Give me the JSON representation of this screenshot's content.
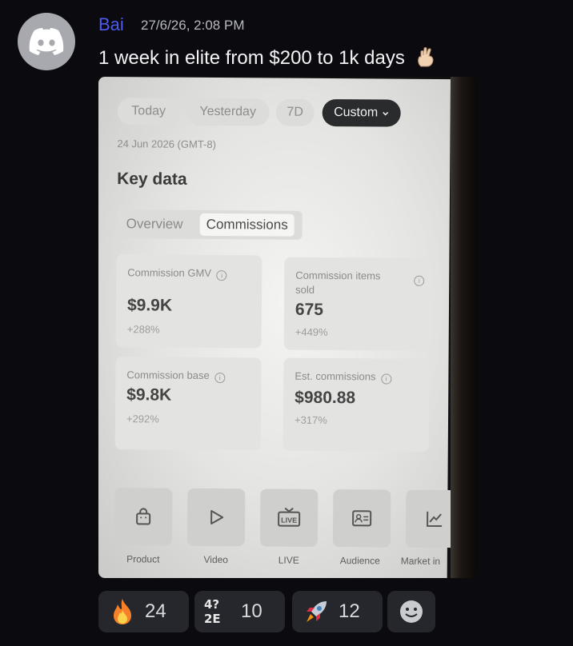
{
  "message": {
    "username": "Bai",
    "timestamp": "27/6/26, 2:08 PM",
    "text": "1 week in elite from $200 to 1k days",
    "text_emoji": "crossed-fingers-icon"
  },
  "photo": {
    "filters": [
      {
        "label": "Today",
        "active": false
      },
      {
        "label": "Yesterday",
        "active": false
      },
      {
        "label": "7D",
        "active": false
      },
      {
        "label": "Custom",
        "active": true
      }
    ],
    "date": "24 Jun 2026 (GMT-8)",
    "section_title": "Key data",
    "tabs": [
      {
        "label": "Overview",
        "active": false
      },
      {
        "label": "Commissions",
        "active": true
      }
    ],
    "cards": [
      {
        "label": "Commission GMV",
        "value": "$9.9K",
        "change": "+288%"
      },
      {
        "label": "Commission items sold",
        "value": "675",
        "change": "+449%"
      },
      {
        "label": "Commission base",
        "value": "$9.8K",
        "change": "+292%"
      },
      {
        "label": "Est. commissions",
        "value": "$980.88",
        "change": "+317%"
      }
    ],
    "tools": [
      {
        "label": "Product",
        "icon": "shopping-bag-icon"
      },
      {
        "label": "Video",
        "icon": "play-icon"
      },
      {
        "label": "LIVE",
        "icon": "live-tv-icon"
      },
      {
        "label": "Audience",
        "icon": "id-card-icon"
      },
      {
        "label": "Market in",
        "icon": "chart-icon"
      }
    ],
    "live_text": "LIVE"
  },
  "reactions": [
    {
      "icon": "fire-icon",
      "count": "24"
    },
    {
      "icon": "custom-emoji-icon",
      "count": "10",
      "emoji_text": "4?2E"
    },
    {
      "icon": "rocket-icon",
      "count": "12"
    },
    {
      "icon": "add-reaction-icon",
      "count": ""
    }
  ]
}
